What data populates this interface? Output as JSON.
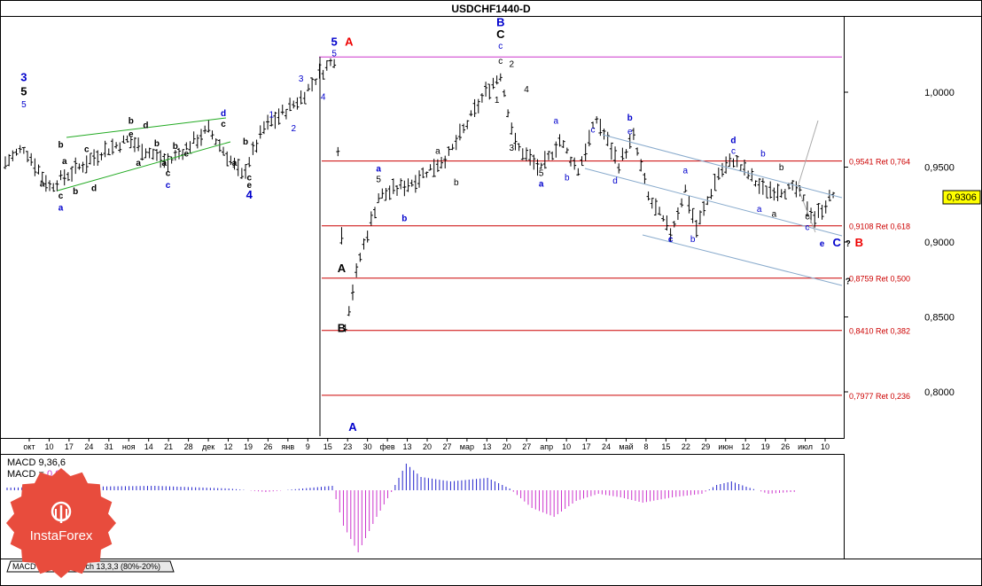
{
  "title": "USDCHF1440-D",
  "colors": {
    "axis": "#000000",
    "fib": "#cc0000",
    "magenta": "#cc33cc",
    "channel": "#88aacc",
    "bull": "#2222cc",
    "bear": "#cc33cc",
    "green": "#22aa22",
    "blue_label": "#0000cc",
    "red_label": "#ee0000",
    "price_badge": "#ffff00"
  },
  "current_price": "0,9306",
  "chart_data": {
    "type": "ohlc",
    "title": "USDCHF1440-D",
    "y_ticks": [
      "1,0000",
      "0,9500",
      "0,9000",
      "0,8500",
      "0,8000"
    ],
    "x_ticks": [
      "окт",
      "10",
      "17",
      "24",
      "31",
      "ноя",
      "14",
      "21",
      "28",
      "дек",
      "12",
      "19",
      "26",
      "янв",
      "9",
      "15",
      "23",
      "30",
      "фев",
      "13",
      "20",
      "27",
      "мар",
      "13",
      "20",
      "27",
      "апр",
      "10",
      "17",
      "24",
      "май",
      "8",
      "15",
      "22",
      "29",
      "июн",
      "12",
      "19",
      "26",
      "июл",
      "10"
    ],
    "fib_levels": [
      {
        "label": "0,9541 Ret 0,764",
        "value": 0.9541
      },
      {
        "label": "0,9108 Ret 0,618",
        "value": 0.9108
      },
      {
        "label": "0,8759 Ret 0,500",
        "value": 0.8759
      },
      {
        "label": "0,8410 Ret 0,382",
        "value": 0.841
      },
      {
        "label": "0,7977 Ret 0,236",
        "value": 0.7977
      }
    ],
    "ylim": [
      0.77,
      1.03
    ],
    "wave_labels": [
      {
        "t": "3",
        "c": "blue_label",
        "b": true,
        "i": 5,
        "v": 1.0075
      },
      {
        "t": "5",
        "c": "black",
        "b": true,
        "i": 5,
        "v": 0.998
      },
      {
        "t": "5",
        "c": "blue_label",
        "b": false,
        "i": 5,
        "v": 0.99
      },
      {
        "t": "b",
        "c": "black",
        "b": true,
        "i": 15,
        "v": 0.963
      },
      {
        "t": "a",
        "c": "black",
        "b": true,
        "i": 10,
        "v": 0.937
      },
      {
        "t": "a",
        "c": "black",
        "b": true,
        "i": 16,
        "v": 0.952
      },
      {
        "t": "c",
        "c": "black",
        "b": true,
        "i": 15,
        "v": 0.929
      },
      {
        "t": "a",
        "c": "blue_label",
        "b": true,
        "i": 15,
        "v": 0.921
      },
      {
        "t": "b",
        "c": "black",
        "b": true,
        "i": 19,
        "v": 0.932
      },
      {
        "t": "c",
        "c": "black",
        "b": true,
        "i": 22,
        "v": 0.96
      },
      {
        "t": "d",
        "c": "black",
        "b": true,
        "i": 24,
        "v": 0.934
      },
      {
        "t": "b",
        "c": "black",
        "b": true,
        "i": 34,
        "v": 0.979
      },
      {
        "t": "e",
        "c": "black",
        "b": true,
        "i": 34,
        "v": 0.97
      },
      {
        "t": "a",
        "c": "black",
        "b": true,
        "i": 36,
        "v": 0.951
      },
      {
        "t": "d",
        "c": "black",
        "b": true,
        "i": 38,
        "v": 0.976
      },
      {
        "t": "b",
        "c": "black",
        "b": true,
        "i": 41,
        "v": 0.964
      },
      {
        "t": "a",
        "c": "black",
        "b": true,
        "i": 43,
        "v": 0.951
      },
      {
        "t": "c",
        "c": "black",
        "b": true,
        "i": 44,
        "v": 0.944
      },
      {
        "t": "c",
        "c": "blue_label",
        "b": true,
        "i": 44,
        "v": 0.936
      },
      {
        "t": "b",
        "c": "black",
        "b": true,
        "i": 46,
        "v": 0.962
      },
      {
        "t": "e",
        "c": "black",
        "b": true,
        "i": 49,
        "v": 0.957
      },
      {
        "t": "d",
        "c": "blue_label",
        "b": true,
        "i": 59,
        "v": 0.984
      },
      {
        "t": "c",
        "c": "black",
        "b": true,
        "i": 59,
        "v": 0.977
      },
      {
        "t": "b",
        "c": "black",
        "b": true,
        "i": 65,
        "v": 0.965
      },
      {
        "t": "a",
        "c": "black",
        "b": true,
        "i": 62,
        "v": 0.951
      },
      {
        "t": "c",
        "c": "black",
        "b": true,
        "i": 66,
        "v": 0.941
      },
      {
        "t": "e",
        "c": "black",
        "b": true,
        "i": 66,
        "v": 0.936
      },
      {
        "t": "4",
        "c": "blue_label",
        "b": true,
        "i": 66,
        "v": 0.929
      },
      {
        "t": "1",
        "c": "blue_label",
        "b": false,
        "i": 72,
        "v": 0.983
      },
      {
        "t": "2",
        "c": "blue_label",
        "b": false,
        "i": 78,
        "v": 0.974
      },
      {
        "t": "3",
        "c": "blue_label",
        "b": false,
        "i": 80,
        "v": 1.007
      },
      {
        "t": "4",
        "c": "blue_label",
        "b": false,
        "i": 86,
        "v": 0.995
      },
      {
        "t": "5",
        "c": "blue_label",
        "b": true,
        "i": 89,
        "v": 1.031
      },
      {
        "t": "5",
        "c": "blue_label",
        "b": false,
        "i": 89,
        "v": 1.024
      },
      {
        "t": "A",
        "c": "red_label",
        "b": true,
        "i": 93,
        "v": 1.031
      },
      {
        "t": "A",
        "c": "black",
        "b": true,
        "i": 91,
        "v": 0.88
      },
      {
        "t": "B",
        "c": "black",
        "b": true,
        "i": 91,
        "v": 0.84
      },
      {
        "t": "A",
        "c": "blue_label",
        "b": true,
        "i": 94,
        "v": 0.774
      },
      {
        "t": "a",
        "c": "blue_label",
        "b": true,
        "i": 101,
        "v": 0.947
      },
      {
        "t": "5",
        "c": "black",
        "b": false,
        "i": 101,
        "v": 0.94
      },
      {
        "t": "b",
        "c": "blue_label",
        "b": true,
        "i": 108,
        "v": 0.914
      },
      {
        "t": "a",
        "c": "black",
        "b": false,
        "i": 117,
        "v": 0.959
      },
      {
        "t": "b",
        "c": "black",
        "b": false,
        "i": 122,
        "v": 0.938
      },
      {
        "t": "B",
        "c": "blue_label",
        "b": true,
        "i": 134,
        "v": 1.044
      },
      {
        "t": "C",
        "c": "black",
        "b": true,
        "i": 134,
        "v": 1.036
      },
      {
        "t": "c",
        "c": "blue_label",
        "b": false,
        "i": 134,
        "v": 1.029
      },
      {
        "t": "c",
        "c": "black",
        "b": false,
        "i": 134,
        "v": 1.019
      },
      {
        "t": "2",
        "c": "black",
        "b": false,
        "i": 137,
        "v": 1.017
      },
      {
        "t": "1",
        "c": "black",
        "b": false,
        "i": 133,
        "v": 0.993
      },
      {
        "t": "4",
        "c": "black",
        "b": false,
        "i": 141,
        "v": 1.0
      },
      {
        "t": "3",
        "c": "black",
        "b": false,
        "i": 137,
        "v": 0.961
      },
      {
        "t": "5",
        "c": "black",
        "b": false,
        "i": 145,
        "v": 0.944
      },
      {
        "t": "a",
        "c": "blue_label",
        "b": true,
        "i": 145,
        "v": 0.937
      },
      {
        "t": "a",
        "c": "blue_label",
        "b": false,
        "i": 149,
        "v": 0.979
      },
      {
        "t": "b",
        "c": "blue_label",
        "b": false,
        "i": 152,
        "v": 0.941
      },
      {
        "t": "c",
        "c": "blue_label",
        "b": false,
        "i": 159,
        "v": 0.973
      },
      {
        "t": "d",
        "c": "blue_label",
        "b": false,
        "i": 165,
        "v": 0.939
      },
      {
        "t": "b",
        "c": "blue_label",
        "b": true,
        "i": 169,
        "v": 0.981
      },
      {
        "t": "e",
        "c": "blue_label",
        "b": false,
        "i": 169,
        "v": 0.972
      },
      {
        "t": "a",
        "c": "blue_label",
        "b": false,
        "i": 184,
        "v": 0.946
      },
      {
        "t": "c",
        "c": "blue_label",
        "b": true,
        "i": 180,
        "v": 0.9
      },
      {
        "t": "b",
        "c": "blue_label",
        "b": false,
        "i": 186,
        "v": 0.9
      },
      {
        "t": "d",
        "c": "blue_label",
        "b": true,
        "i": 197,
        "v": 0.966
      },
      {
        "t": "c",
        "c": "blue_label",
        "b": false,
        "i": 197,
        "v": 0.959
      },
      {
        "t": "b",
        "c": "blue_label",
        "b": false,
        "i": 205,
        "v": 0.957
      },
      {
        "t": "b",
        "c": "black",
        "b": false,
        "i": 210,
        "v": 0.948
      },
      {
        "t": "a",
        "c": "blue_label",
        "b": false,
        "i": 204,
        "v": 0.92
      },
      {
        "t": "a",
        "c": "black",
        "b": false,
        "i": 208,
        "v": 0.917
      },
      {
        "t": "c",
        "c": "black",
        "b": false,
        "i": 217,
        "v": 0.915
      },
      {
        "t": "c",
        "c": "blue_label",
        "b": false,
        "i": 217,
        "v": 0.908
      },
      {
        "t": "e",
        "c": "blue_label",
        "b": true,
        "i": 221,
        "v": 0.897
      },
      {
        "t": "C",
        "c": "blue_label",
        "b": true,
        "i": 225,
        "v": 0.897
      },
      {
        "t": "?",
        "c": "black",
        "b": true,
        "i": 228,
        "v": 0.897
      },
      {
        "t": "B",
        "c": "red_label",
        "b": true,
        "i": 231,
        "v": 0.897
      },
      {
        "t": "?",
        "c": "black",
        "b": true,
        "i": 228,
        "v": 0.872
      }
    ],
    "start_close": 0.952,
    "bars": 225
  },
  "macd": {
    "label1": "MACD 9,36,6",
    "label2": "MACD = ",
    "value": "0,00"
  },
  "tabs": [
    {
      "label": "MACD 9,36,6"
    },
    {
      "label": "Stoch 13,3,3 (80%-20%)"
    }
  ],
  "watermark": "InstaForex"
}
